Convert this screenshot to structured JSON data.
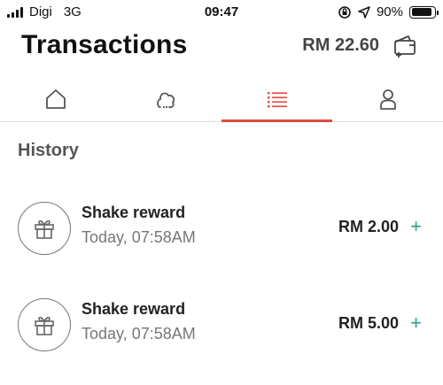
{
  "status_bar": {
    "carrier": "Digi",
    "network": "3G",
    "time": "09:47",
    "battery": "90%",
    "battery_level": 0.9
  },
  "header": {
    "title": "Transactions",
    "balance": "RM 22.60",
    "wallet_icon": "wallet-add-icon"
  },
  "tabs": [
    {
      "id": "home",
      "icon": "home-icon",
      "active": false
    },
    {
      "id": "rewards",
      "icon": "rewards-icon",
      "active": false
    },
    {
      "id": "transactions",
      "icon": "list-icon",
      "active": true
    },
    {
      "id": "profile",
      "icon": "profile-icon",
      "active": false
    }
  ],
  "colors": {
    "accent": "#e04a42",
    "credit": "#2e9e88"
  },
  "history": {
    "title": "History",
    "items": [
      {
        "title": "Shake reward",
        "time": "Today, 07:58AM",
        "amount": "RM 2.00",
        "sign": "+",
        "icon": "gift-icon"
      },
      {
        "title": "Shake reward",
        "time": "Today, 07:58AM",
        "amount": "RM 5.00",
        "sign": "+",
        "icon": "gift-icon"
      }
    ]
  }
}
